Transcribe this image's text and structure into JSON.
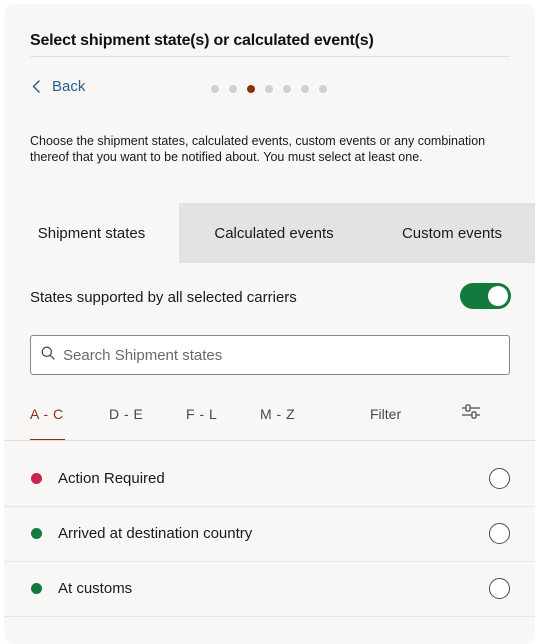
{
  "dialog": {
    "title": "Select shipment state(s) or calculated event(s)",
    "back_label": "Back",
    "step_dots": [
      false,
      false,
      true,
      false,
      false,
      false,
      false
    ],
    "intro": "Choose the shipment states, calculated events, custom events or any combination thereof that you want to be notified about. You must select at least one."
  },
  "tabs": [
    {
      "label": "Shipment states",
      "active": true
    },
    {
      "label": "Calculated events",
      "active": false
    },
    {
      "label": "Custom events",
      "active": false
    }
  ],
  "toggle": {
    "label": "States supported by all selected carriers",
    "on": true
  },
  "search": {
    "placeholder": "Search Shipment states",
    "value": ""
  },
  "alpha_tabs": [
    {
      "label": "A - C",
      "active": true
    },
    {
      "label": "D - E",
      "active": false
    },
    {
      "label": "F - L",
      "active": false
    },
    {
      "label": "M - Z",
      "active": false
    }
  ],
  "filter": {
    "label": "Filter",
    "icon": "sliders-icon"
  },
  "states": [
    {
      "label": "Action Required",
      "color": "#c8264c",
      "selected": false
    },
    {
      "label": "Arrived at destination country",
      "color": "#117a3c",
      "selected": false
    },
    {
      "label": "At customs",
      "color": "#117a3c",
      "selected": false
    }
  ],
  "colors": {
    "accent": "#8b3112",
    "toggle_on": "#117a3c",
    "link": "#2a5d8f"
  }
}
